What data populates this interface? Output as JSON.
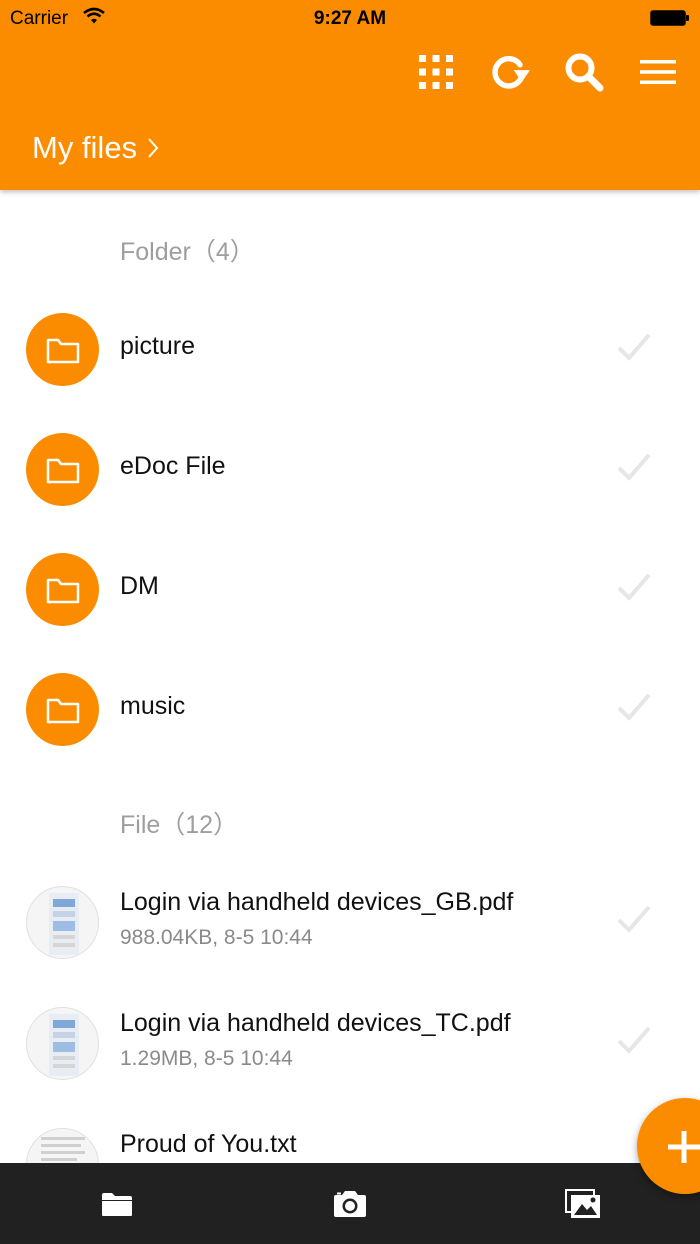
{
  "status_bar": {
    "carrier": "Carrier",
    "time": "9:27 AM"
  },
  "toolbar": {
    "buttons": [
      {
        "icon": "grid-icon"
      },
      {
        "icon": "refresh-icon"
      },
      {
        "icon": "search-icon"
      },
      {
        "icon": "menu-icon"
      }
    ]
  },
  "breadcrumb": {
    "label": "My files"
  },
  "sections": {
    "folders_title": "Folder（4）",
    "files_title": "File（12）"
  },
  "folders": [
    {
      "name": "picture"
    },
    {
      "name": "eDoc File"
    },
    {
      "name": "DM"
    },
    {
      "name": "music"
    }
  ],
  "files": [
    {
      "name": "Login via handheld devices_GB.pdf",
      "meta": "988.04KB, 8-5 10:44"
    },
    {
      "name": "Login via handheld devices_TC.pdf",
      "meta": "1.29MB, 8-5 10:44"
    },
    {
      "name": "Proud of You.txt",
      "meta": ""
    }
  ],
  "bottom_bar": {
    "buttons": [
      "folder-icon",
      "camera-icon",
      "gallery-icon"
    ]
  },
  "colors": {
    "accent": "#fb8c00",
    "bottom_bar": "#212121",
    "check": "#e6e6e6"
  }
}
